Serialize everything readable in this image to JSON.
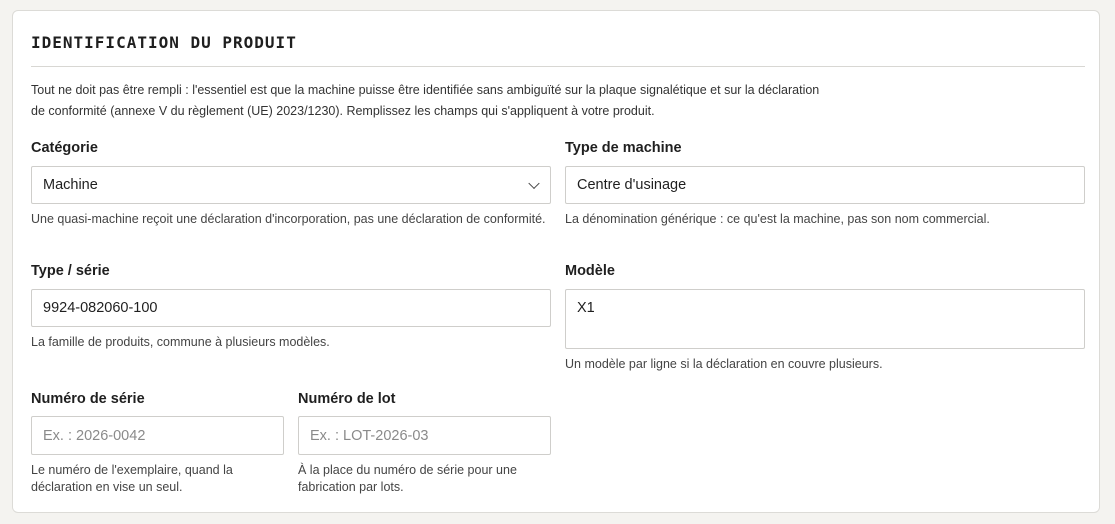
{
  "section": {
    "title": "IDENTIFICATION DU PRODUIT",
    "intro_line1": "Tout ne doit pas être rempli : l'essentiel est que la machine puisse être identifiée sans ambiguïté sur la plaque signalétique et sur la déclaration",
    "intro_line2": "de conformité (annexe V du règlement (UE) 2023/1230). Remplissez les champs qui s'appliquent à votre produit."
  },
  "fields": {
    "categorie": {
      "label": "Catégorie",
      "value": "Machine",
      "help": "Une quasi-machine reçoit une déclaration d'incorporation, pas une déclaration de conformité."
    },
    "type_machine": {
      "label": "Type de machine",
      "value": "Centre d'usinage",
      "help": "La dénomination générique : ce qu'est la machine, pas son nom commercial."
    },
    "type_serie": {
      "label": "Type / série",
      "value": "9924-082060-100",
      "help": "La famille de produits, commune à plusieurs modèles."
    },
    "modele": {
      "label": "Modèle",
      "value": "X1",
      "help": "Un modèle par ligne si la déclaration en couvre plusieurs."
    },
    "numero_serie": {
      "label": "Numéro de série",
      "placeholder": "Ex. : 2026-0042",
      "help": "Le numéro de l'exemplaire, quand la déclaration en vise un seul."
    },
    "numero_lot": {
      "label": "Numéro de lot",
      "placeholder": "Ex. : LOT-2026-03",
      "help": "À la place du numéro de série pour une fabrication par lots."
    }
  }
}
